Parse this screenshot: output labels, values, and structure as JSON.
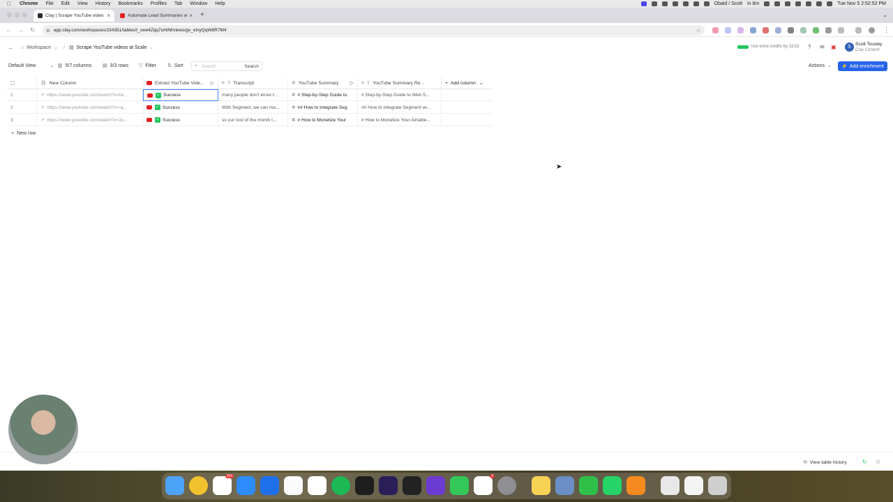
{
  "menubar": {
    "app": "Chrome",
    "items": [
      "File",
      "Edit",
      "View",
      "History",
      "Bookmarks",
      "Profiles",
      "Tab",
      "Window",
      "Help"
    ],
    "status_user": "Obaid / Scott",
    "status_timer": "in 8m",
    "clock": "Tue Nov 5  2:52:52 PM"
  },
  "tabs": [
    {
      "title": "Clay | Scrape YouTube video",
      "active": true
    },
    {
      "title": "Automate Lead Summaries w",
      "active": false
    }
  ],
  "address": {
    "url": "app.clay.com/workspaces/234351/tables/t_cwe4Zqq7uHrM/views/gv_eIxyQqW8R7M4"
  },
  "breadcrumb": {
    "workspace": "Workspace",
    "separator": "/",
    "table_name": "Scrape YouTube videos at Scale"
  },
  "header_right": {
    "credits_text": "Use extra credits by 11/13",
    "user_name": "Scott Tousley",
    "user_org": "Clay Content",
    "avatar_letter": "S"
  },
  "toolbar": {
    "view": "Default View",
    "columns": "5/7 columns",
    "rows": "3/3 rows",
    "filter": "Filter",
    "sort": "Sort",
    "search_placeholder": "Search",
    "search_label": "Search",
    "actions": "Actions",
    "add_enrichment": "Add enrichment"
  },
  "table": {
    "columns": [
      {
        "label": "New Column"
      },
      {
        "label": "Extract YouTube Vide..."
      },
      {
        "label": "Transcript"
      },
      {
        "label": "YouTube Summary"
      },
      {
        "label": "YouTube Summary Re..."
      }
    ],
    "add_column": "Add column",
    "rows": [
      {
        "num": "1",
        "url": "https://www.youtube.com/watch?v=tw...",
        "status": "Success",
        "transcript": "many people don't know t...",
        "summary": "# Step-by-Step Guide to",
        "summary_re": "# Step-by-Step Guide to Web S..."
      },
      {
        "num": "2",
        "url": "https://www.youtube.com/watch?v=-q...",
        "status": "Success",
        "transcript": "With Segment, we can ma...",
        "summary": "## How to Integrate Seg",
        "summary_re": "## How to Integrate Segment wi..."
      },
      {
        "num": "3",
        "url": "https://www.youtube.com/watch?v=2v...",
        "status": "Success",
        "transcript": "so our tool of the month t...",
        "summary": "# How to Monetize Your",
        "summary_re": "# How to Monetize Your Airtable..."
      }
    ],
    "new_row": "New row"
  },
  "footer": {
    "history": "View table history"
  },
  "dock": {
    "slack_badge": "164",
    "reminders_badge": "8"
  }
}
